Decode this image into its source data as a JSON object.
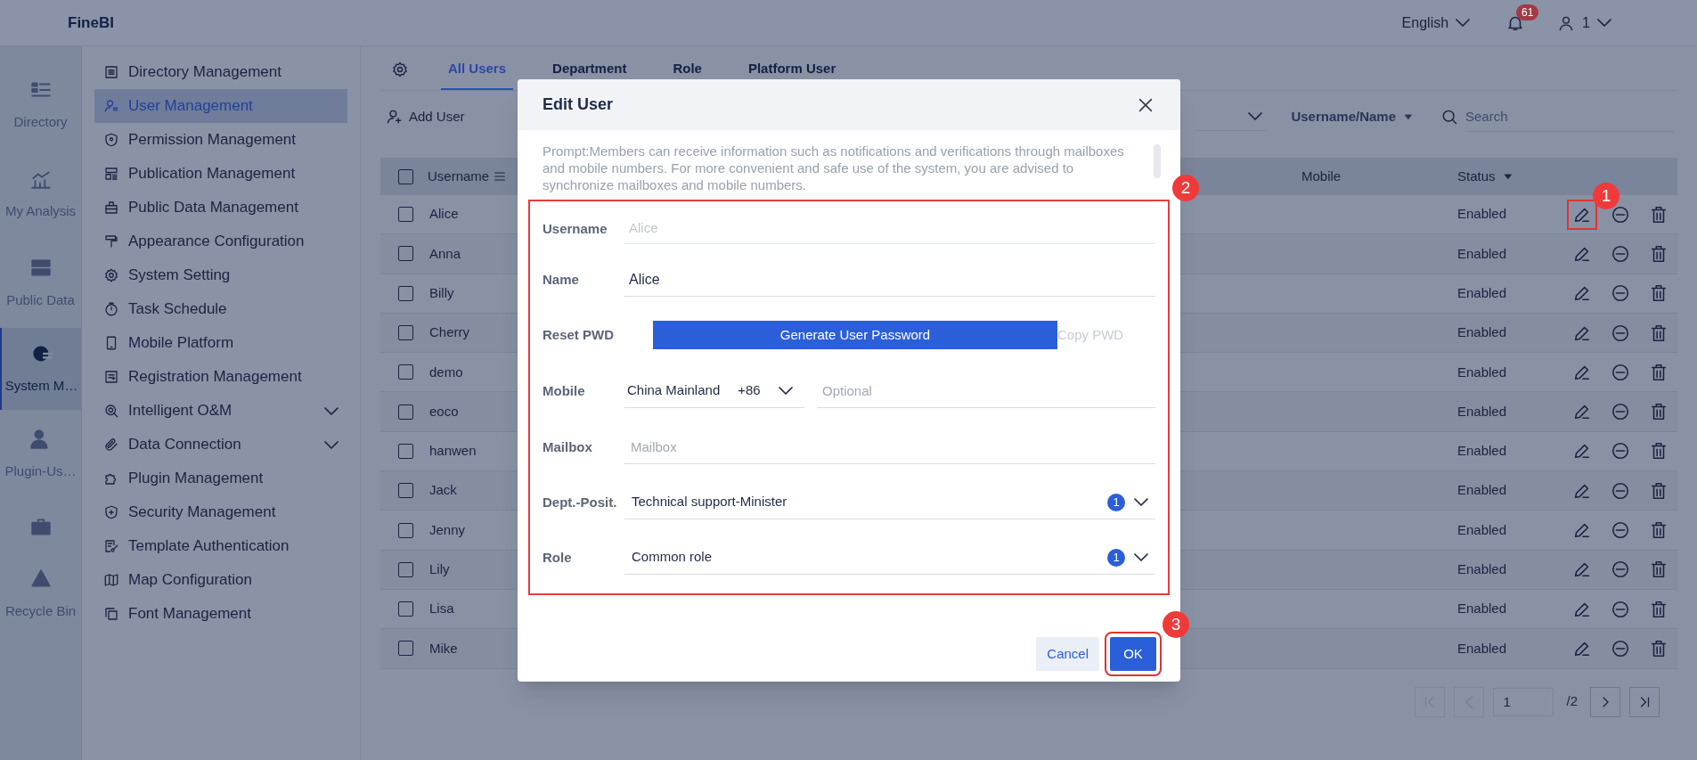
{
  "app": {
    "title": "FineBI"
  },
  "header": {
    "language": "English",
    "notifications": "61",
    "user": "1"
  },
  "icon_rail": [
    {
      "label": "Directory",
      "selected": false
    },
    {
      "label": "My Analysis",
      "selected": false
    },
    {
      "label": "Public Data",
      "selected": false
    },
    {
      "label": "System M…",
      "selected": true
    },
    {
      "label": "Plugin-Us…",
      "selected": false
    },
    {
      "selected": false
    },
    {
      "label": "Recycle Bin",
      "selected": false
    }
  ],
  "nav": [
    {
      "label": "Directory Management",
      "selected": false,
      "has_submenu": false
    },
    {
      "label": "User Management",
      "selected": true,
      "has_submenu": false
    },
    {
      "label": "Permission Management",
      "selected": false,
      "has_submenu": false
    },
    {
      "label": "Publication Management",
      "selected": false,
      "has_submenu": false
    },
    {
      "label": "Public Data Management",
      "selected": false,
      "has_submenu": false
    },
    {
      "label": "Appearance Configuration",
      "selected": false,
      "has_submenu": false
    },
    {
      "label": "System Setting",
      "selected": false,
      "has_submenu": false
    },
    {
      "label": "Task Schedule",
      "selected": false,
      "has_submenu": false
    },
    {
      "label": "Mobile Platform",
      "selected": false,
      "has_submenu": false
    },
    {
      "label": "Registration Management",
      "selected": false,
      "has_submenu": false
    },
    {
      "label": "Intelligent O&M",
      "selected": false,
      "has_submenu": true
    },
    {
      "label": "Data Connection",
      "selected": false,
      "has_submenu": true
    },
    {
      "label": "Plugin Management",
      "selected": false,
      "has_submenu": false
    },
    {
      "label": "Security Management",
      "selected": false,
      "has_submenu": false
    },
    {
      "label": "Template Authentication",
      "selected": false,
      "has_submenu": false
    },
    {
      "label": "Map Configuration",
      "selected": false,
      "has_submenu": false
    },
    {
      "label": "Font Management",
      "selected": false,
      "has_submenu": false
    }
  ],
  "tabs": [
    {
      "label": "All Users",
      "selected": true
    },
    {
      "label": "Department",
      "selected": false
    },
    {
      "label": "Role",
      "selected": false
    },
    {
      "label": "Platform User",
      "selected": false
    }
  ],
  "toolbar": {
    "add_user": "Add User",
    "filter_field": "Username/Name",
    "search_placeholder": "Search"
  },
  "table": {
    "columns": [
      "Username",
      "Mobile",
      "Status"
    ],
    "select_all_checked": false,
    "rows": [
      {
        "username": "Alice",
        "status": "Enabled",
        "checked": false
      },
      {
        "username": "Anna",
        "status": "Enabled",
        "checked": false
      },
      {
        "username": "Billy",
        "status": "Enabled",
        "checked": false
      },
      {
        "username": "Cherry",
        "status": "Enabled",
        "checked": false
      },
      {
        "username": "demo",
        "status": "Enabled",
        "checked": false
      },
      {
        "username": "eoco",
        "status": "Enabled",
        "checked": false
      },
      {
        "username": "hanwen",
        "status": "Enabled",
        "checked": false
      },
      {
        "username": "Jack",
        "status": "Enabled",
        "checked": false
      },
      {
        "username": "Jenny",
        "status": "Enabled",
        "checked": false
      },
      {
        "username": "Lily",
        "status": "Enabled",
        "checked": false
      },
      {
        "username": "Lisa",
        "status": "Enabled",
        "checked": false
      },
      {
        "username": "Mike",
        "status": "Enabled",
        "checked": false
      }
    ]
  },
  "pagination": {
    "page": "1",
    "total": "/2"
  },
  "dialog": {
    "title": "Edit User",
    "prompt": "Prompt:Members can receive information such as notifications and verifications through mailboxes and mobile numbers. For more convenient and safe use of the system, you are advised to synchronize mailboxes and mobile numbers.",
    "username": {
      "label": "Username",
      "value": "Alice",
      "disabled": true
    },
    "name": {
      "label": "Name",
      "value": "Alice"
    },
    "reset_pwd": {
      "label": "Reset PWD",
      "button": "Generate User Password",
      "copy": "Copy PWD"
    },
    "mobile": {
      "label": "Mobile",
      "region": "China Mainland",
      "code": "+86",
      "placeholder": "Optional"
    },
    "mailbox": {
      "label": "Mailbox",
      "placeholder": "Mailbox"
    },
    "department": {
      "label": "Dept.-Posit.",
      "value": "Technical support-Minister",
      "count": "1"
    },
    "role": {
      "label": "Role",
      "value": "Common role",
      "count": "1"
    },
    "buttons": {
      "cancel": "Cancel",
      "ok": "OK"
    }
  },
  "annotations": [
    {
      "label": "1"
    },
    {
      "label": "2"
    },
    {
      "label": "3"
    }
  ]
}
